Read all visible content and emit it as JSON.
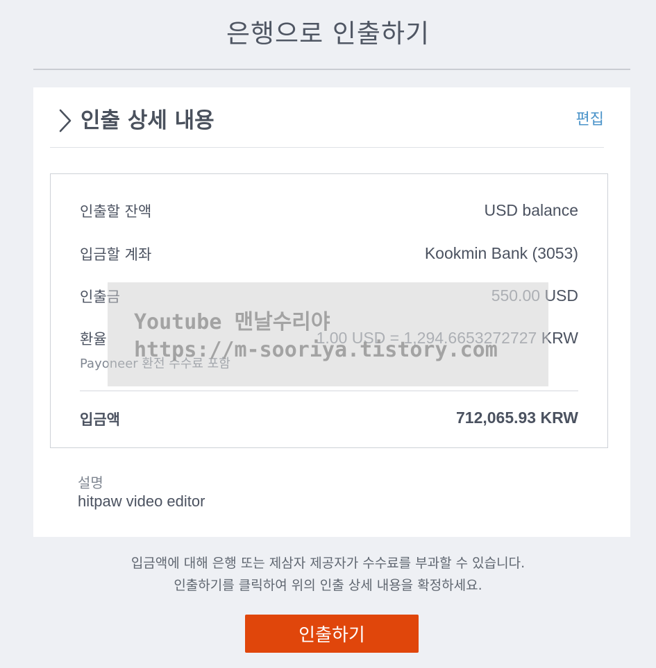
{
  "page": {
    "title": "은행으로 인출하기"
  },
  "section": {
    "title": "인출 상세 내용",
    "edit_label": "편집"
  },
  "details": {
    "balance": {
      "label": "인출할 잔액",
      "value": "USD balance"
    },
    "account": {
      "label": "입금할 계좌",
      "value": "Kookmin Bank (3053)"
    },
    "amount": {
      "label": "인출금",
      "value": "550.00",
      "currency": "USD"
    },
    "rate": {
      "label": "환율",
      "sub": "Payoneer 환전 수수료 포함",
      "value": "1.00 USD = 1,294.6653272727",
      "currency": "KRW"
    },
    "total": {
      "label": "입금액",
      "value": "712,065.93 KRW"
    }
  },
  "memo": {
    "label": "설명",
    "value": "hitpaw video editor"
  },
  "notice": {
    "line1": "입금액에 대해 은행 또는 제삼자 제공자가 수수료를 부과할 수 있습니다.",
    "line2": "인출하기를 클릭하여 위의 인출 상세 내용을 확정하세요."
  },
  "watermark": {
    "line1": "Youtube 맨날수리야",
    "line2": "https://m-sooriya.tistory.com"
  },
  "actions": {
    "withdraw_label": "인출하기"
  },
  "colors": {
    "accent_button": "#e0460b",
    "link": "#4a93c9",
    "background": "#eef0f4"
  },
  "icons": {
    "section_toggle": "chevron-right-icon"
  }
}
